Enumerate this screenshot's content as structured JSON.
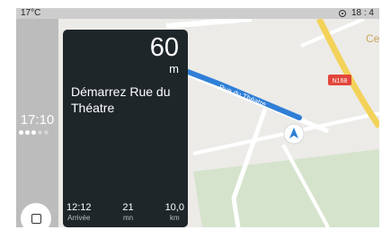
{
  "statusbar": {
    "temperature": "17°C",
    "clock": "18 : 4"
  },
  "sidebar": {
    "time": "17:10",
    "page_dots": [
      true,
      true,
      true,
      false,
      false
    ]
  },
  "navigation": {
    "distance_value": "60",
    "distance_unit": "m",
    "instruction": "Démarrez Rue du Théatre",
    "stats": [
      {
        "value": "12:12",
        "label": "Arrivée"
      },
      {
        "value": "21",
        "label": "mn"
      },
      {
        "value": "10,0",
        "label": "km"
      }
    ]
  },
  "map": {
    "street_label": "Rue du Théatre",
    "road_badge": "N168",
    "place_label": "Ce",
    "route_color": "#2f7fd6",
    "major_road_color": "#f3d25a",
    "badge_color": "#e2453a"
  }
}
